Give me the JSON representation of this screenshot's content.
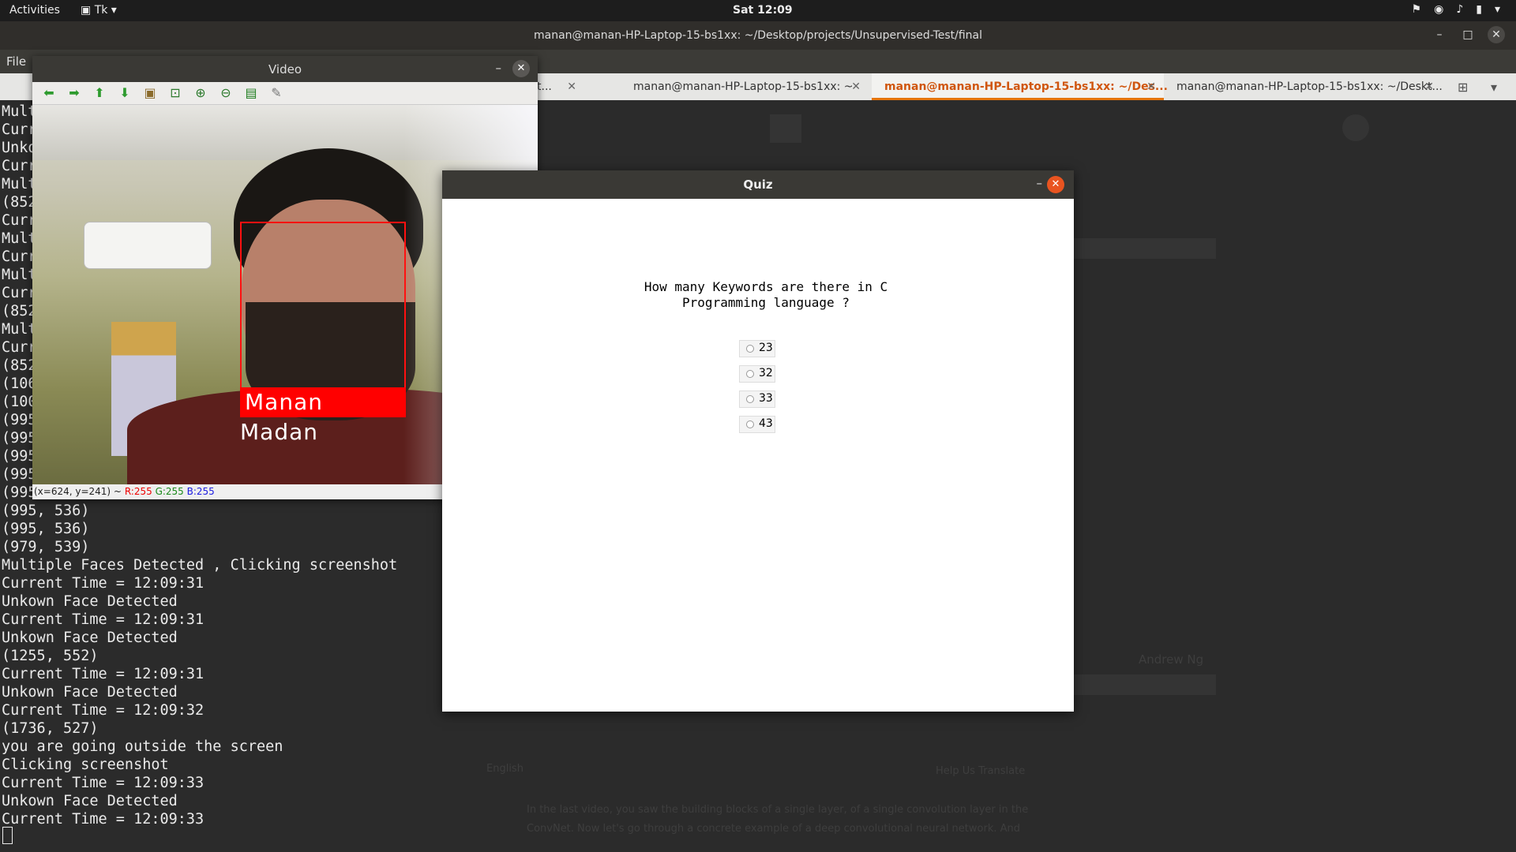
{
  "topbar": {
    "activities": "Activities",
    "app_menu": "Tk",
    "clock": "Sat 12:09"
  },
  "terminal": {
    "title": "manan@manan-HP-Laptop-15-bs1xx: ~/Desktop/projects/Unsupervised-Test/final",
    "menu_file": "File",
    "tabs": [
      {
        "label": "t...",
        "active": false
      },
      {
        "label": "manan@manan-HP-Laptop-15-bs1xx: ~",
        "active": false
      },
      {
        "label": "manan@manan-HP-Laptop-15-bs1xx: ~/Des...",
        "active": true
      },
      {
        "label": "manan@manan-HP-Laptop-15-bs1xx: ~/Deskt...",
        "active": false
      }
    ],
    "lines": [
      "Mult",
      "Curr",
      "Unko",
      "Curr",
      "Mult",
      "(852",
      "Curr",
      "Mult",
      "Curr",
      "Mult",
      "Curr",
      "(852",
      "Mult",
      "Curr",
      "(852",
      "(106",
      "(100",
      "(995",
      "(995",
      "(995",
      "(995",
      "(995",
      "(995, 536)",
      "(995, 536)",
      "(979, 539)",
      "Multiple Faces Detected , Clicking screenshot",
      "Current Time = 12:09:31",
      "Unkown Face Detected",
      "Current Time = 12:09:31",
      "Unkown Face Detected",
      "(1255, 552)",
      "Current Time = 12:09:31",
      "Unkown Face Detected",
      "Current Time = 12:09:32",
      "(1736, 527)",
      "you are going outside the screen",
      "Clicking screenshot",
      "Current Time = 12:09:33",
      "Unkown Face Detected",
      "Current Time = 12:09:33"
    ]
  },
  "video": {
    "title": "Video",
    "face_label": "Manan Madan",
    "status_coords": "(x=624, y=241) ~",
    "status_r": "R:255",
    "status_g": "G:255",
    "status_b": "B:255"
  },
  "quiz": {
    "title": "Quiz",
    "question_line1": "How many Keywords are there in C",
    "question_line2": "Programming language ?",
    "options": [
      "23",
      "32",
      "33",
      "43"
    ]
  },
  "background_page": {
    "author": "Andrew Ng",
    "language": "English",
    "help": "Help Us Translate",
    "transcript": "In the last video, you saw the building blocks of a single layer, of a single convolution layer in the ConvNet. Now let's go through a concrete example of a deep convolutional neural network. And"
  },
  "colors": {
    "accent": "#e95420",
    "face_box": "#ff0000"
  }
}
